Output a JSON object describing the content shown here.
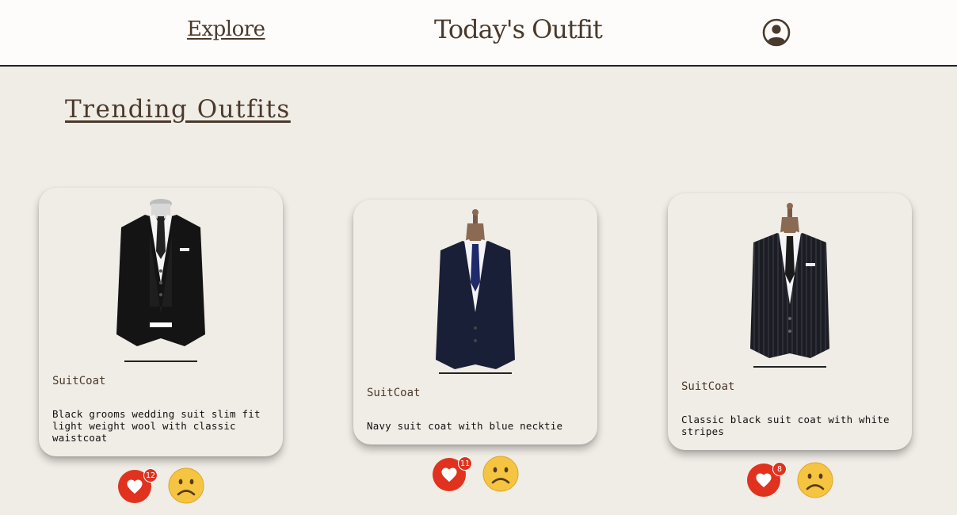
{
  "header": {
    "nav_explore": "Explore",
    "brand": "Today's Outfit",
    "profile_icon": "user-circle-icon"
  },
  "section": {
    "title": "Trending Outfits"
  },
  "outfits": [
    {
      "category": "SuitCoat",
      "description": "Black grooms wedding suit slim fit light weight wool with classic waistcoat",
      "likes": "12",
      "image_icon": "black-suit-waistcoat-image",
      "suit_color": "#141414"
    },
    {
      "category": "SuitCoat",
      "description": "Navy suit coat with blue necktie",
      "likes": "11",
      "image_icon": "navy-suit-image",
      "suit_color": "#1a1f38"
    },
    {
      "category": "SuitCoat",
      "description": "Classic black suit coat with white stripes",
      "likes": "8",
      "image_icon": "pinstripe-suit-image",
      "suit_color": "#1c1d24"
    }
  ],
  "colors": {
    "brand_brown": "#4a3a2c",
    "background": "#f0ece6",
    "like_red": "#e0321e",
    "emoji_yellow": "#f5c542"
  },
  "icons": {
    "like": "heart-icon",
    "dislike": "frown-emoji-icon"
  }
}
